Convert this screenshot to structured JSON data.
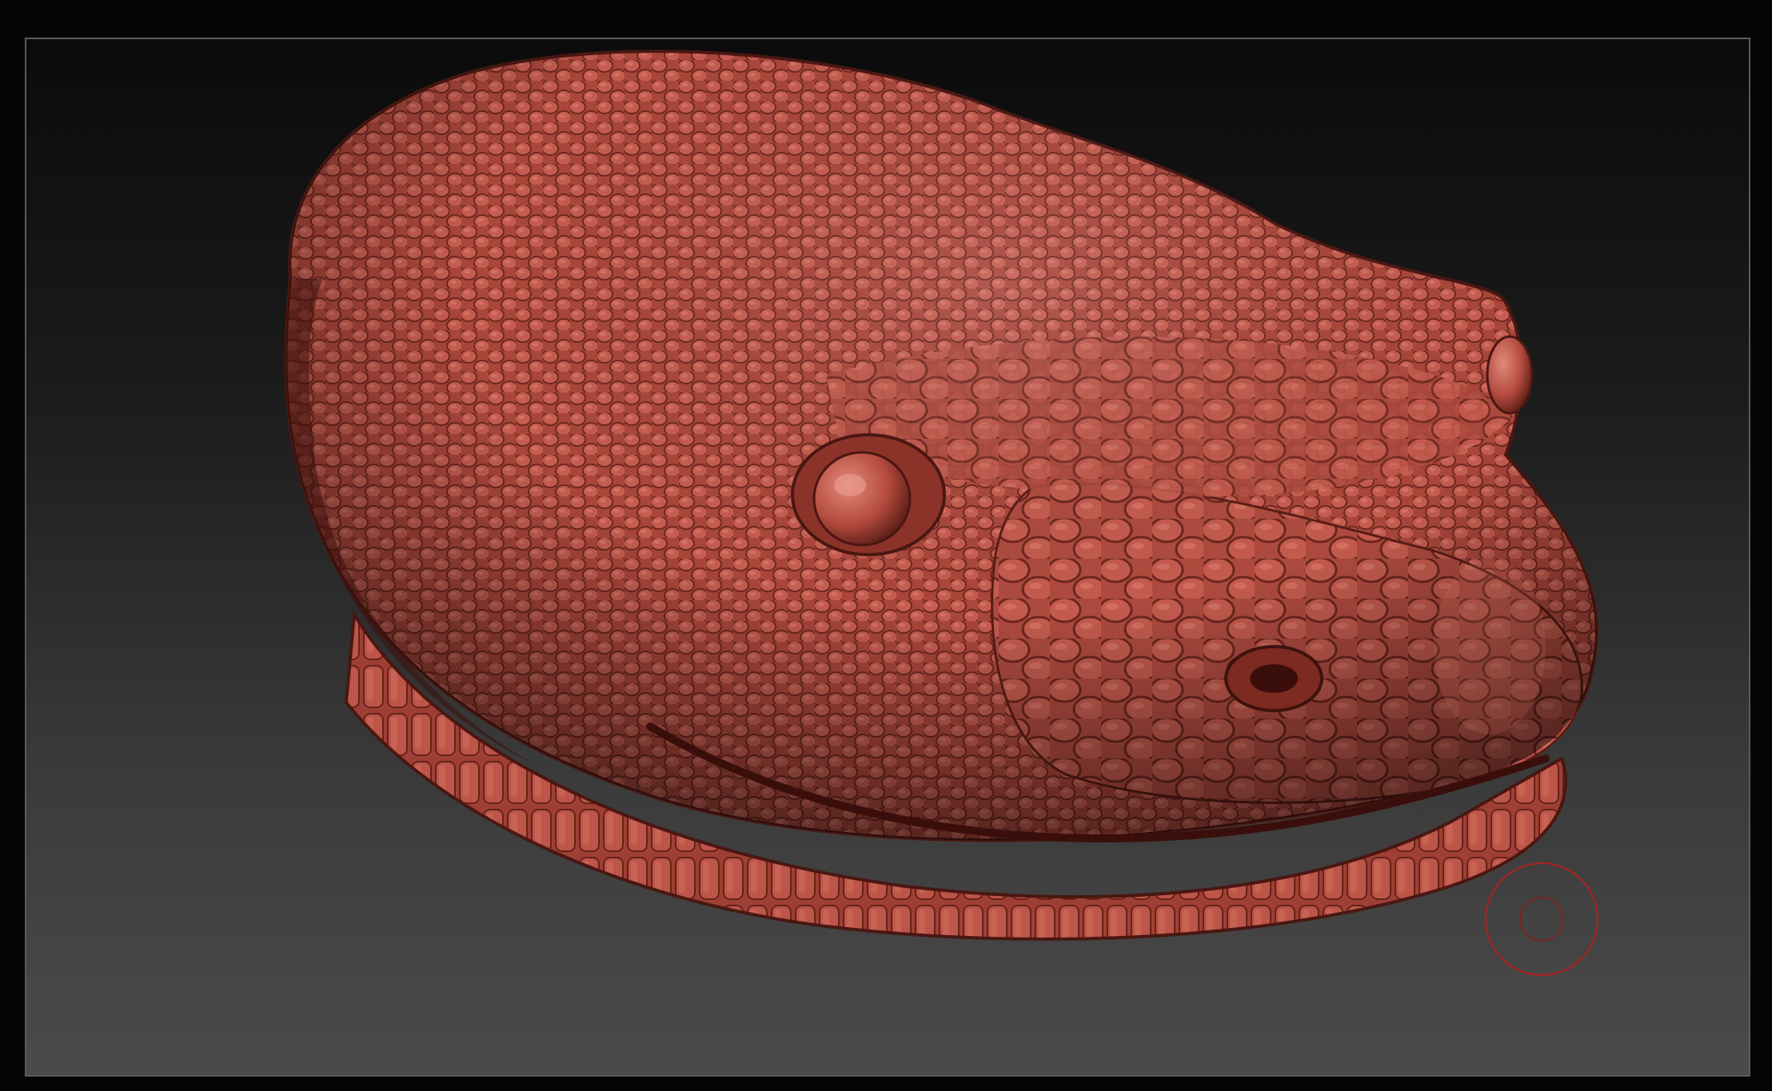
{
  "app": {
    "mode": "sculpt-viewport"
  },
  "model": {
    "icon": "snake-head-sculpt-icon",
    "material_color": "#b84e42",
    "shadow_color": "#5e1f19",
    "highlight_color": "#d9786b"
  },
  "brush_cursor": {
    "icon": "brush-cursor-ring-icon",
    "color": "#b0201c"
  },
  "viewport": {
    "frame_color": "#5a5a5a",
    "background_top": "#0b0b0b",
    "background_bottom": "#4b4b4b"
  }
}
